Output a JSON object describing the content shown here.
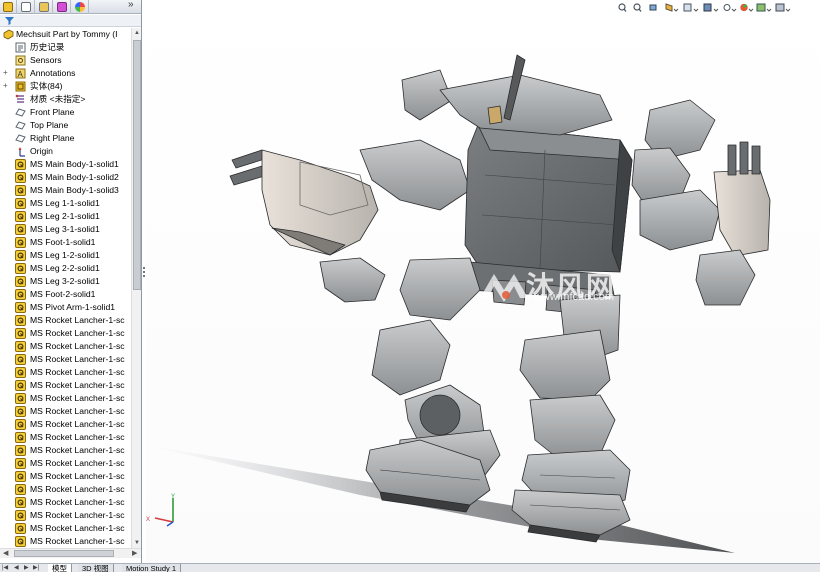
{
  "feature_manager": {
    "tabs": [
      "feature-manager-icon",
      "property-manager-icon",
      "configuration-manager-icon",
      "dimxpert-icon",
      "display-manager-icon"
    ],
    "more": "»",
    "root": {
      "label": "Mechsuit Part by Tommy  (I",
      "icon": "part-icon"
    },
    "items": [
      {
        "label": "历史记录",
        "icon": "history-icon",
        "expander": ""
      },
      {
        "label": "Sensors",
        "icon": "sensors-icon",
        "expander": ""
      },
      {
        "label": "Annotations",
        "icon": "annotations-icon",
        "expander": "+"
      },
      {
        "label": "实体(84)",
        "icon": "solid-bodies-icon",
        "expander": "+"
      },
      {
        "label": "材质 <未指定>",
        "icon": "material-icon",
        "expander": ""
      },
      {
        "label": "Front Plane",
        "icon": "plane-icon",
        "expander": ""
      },
      {
        "label": "Top Plane",
        "icon": "plane-icon",
        "expander": ""
      },
      {
        "label": "Right Plane",
        "icon": "plane-icon",
        "expander": ""
      },
      {
        "label": "Origin",
        "icon": "origin-icon",
        "expander": ""
      },
      {
        "label": "MS Main Body-1-solid1",
        "icon": "body-icon",
        "expander": ""
      },
      {
        "label": "MS Main Body-1-solid2",
        "icon": "body-icon",
        "expander": ""
      },
      {
        "label": "MS Main Body-1-solid3",
        "icon": "body-icon",
        "expander": ""
      },
      {
        "label": "MS Leg 1-1-solid1",
        "icon": "body-icon",
        "expander": ""
      },
      {
        "label": "MS Leg 2-1-solid1",
        "icon": "body-icon",
        "expander": ""
      },
      {
        "label": "MS Leg 3-1-solid1",
        "icon": "body-icon",
        "expander": ""
      },
      {
        "label": "MS Foot-1-solid1",
        "icon": "body-icon",
        "expander": ""
      },
      {
        "label": "MS Leg 1-2-solid1",
        "icon": "body-icon",
        "expander": ""
      },
      {
        "label": "MS Leg 2-2-solid1",
        "icon": "body-icon",
        "expander": ""
      },
      {
        "label": "MS Leg 3-2-solid1",
        "icon": "body-icon",
        "expander": ""
      },
      {
        "label": "MS Foot-2-solid1",
        "icon": "body-icon",
        "expander": ""
      },
      {
        "label": "MS Pivot Arm-1-solid1",
        "icon": "body-icon",
        "expander": ""
      },
      {
        "label": "MS Rocket Lancher-1-sc",
        "icon": "body-icon",
        "expander": ""
      },
      {
        "label": "MS Rocket Lancher-1-sc",
        "icon": "body-icon",
        "expander": ""
      },
      {
        "label": "MS Rocket Lancher-1-sc",
        "icon": "body-icon",
        "expander": ""
      },
      {
        "label": "MS Rocket Lancher-1-sc",
        "icon": "body-icon",
        "expander": ""
      },
      {
        "label": "MS Rocket Lancher-1-sc",
        "icon": "body-icon",
        "expander": ""
      },
      {
        "label": "MS Rocket Lancher-1-sc",
        "icon": "body-icon",
        "expander": ""
      },
      {
        "label": "MS Rocket Lancher-1-sc",
        "icon": "body-icon",
        "expander": ""
      },
      {
        "label": "MS Rocket Lancher-1-sc",
        "icon": "body-icon",
        "expander": ""
      },
      {
        "label": "MS Rocket Lancher-1-sc",
        "icon": "body-icon",
        "expander": ""
      },
      {
        "label": "MS Rocket Lancher-1-sc",
        "icon": "body-icon",
        "expander": ""
      },
      {
        "label": "MS Rocket Lancher-1-sc",
        "icon": "body-icon",
        "expander": ""
      },
      {
        "label": "MS Rocket Lancher-1-sc",
        "icon": "body-icon",
        "expander": ""
      },
      {
        "label": "MS Rocket Lancher-1-sc",
        "icon": "body-icon",
        "expander": ""
      },
      {
        "label": "MS Rocket Lancher-1-sc",
        "icon": "body-icon",
        "expander": ""
      },
      {
        "label": "MS Rocket Lancher-1-sc",
        "icon": "body-icon",
        "expander": ""
      },
      {
        "label": "MS Rocket Lancher-1-sc",
        "icon": "body-icon",
        "expander": ""
      },
      {
        "label": "MS Rocket Lancher-1-sc",
        "icon": "body-icon",
        "expander": ""
      },
      {
        "label": "MS Rocket Lancher-1-sc",
        "icon": "body-icon",
        "expander": ""
      }
    ]
  },
  "bottom_tabs": {
    "tab_model": "模型",
    "tab_3d": "3D 视图",
    "tab_motion": "Motion Study 1"
  },
  "heads_up_toolbar": [
    "zoom-to-fit-icon",
    "zoom-area-icon",
    "previous-view-icon",
    "section-view-icon",
    "view-orientation-icon",
    "display-style-icon",
    "hide-show-icon",
    "edit-appearance-icon",
    "apply-scene-icon",
    "view-settings-icon"
  ],
  "watermark": {
    "brand": "沐风网",
    "url": "www.mfcad.com"
  },
  "triad": {
    "x": "X",
    "y": "Y"
  },
  "colors": {
    "accent": "#1f5fbf",
    "body_icon": "#f4cf3a",
    "model_gray": "#8a8c8e",
    "model_light": "#b4b6b8",
    "model_dark": "#5d6062"
  }
}
